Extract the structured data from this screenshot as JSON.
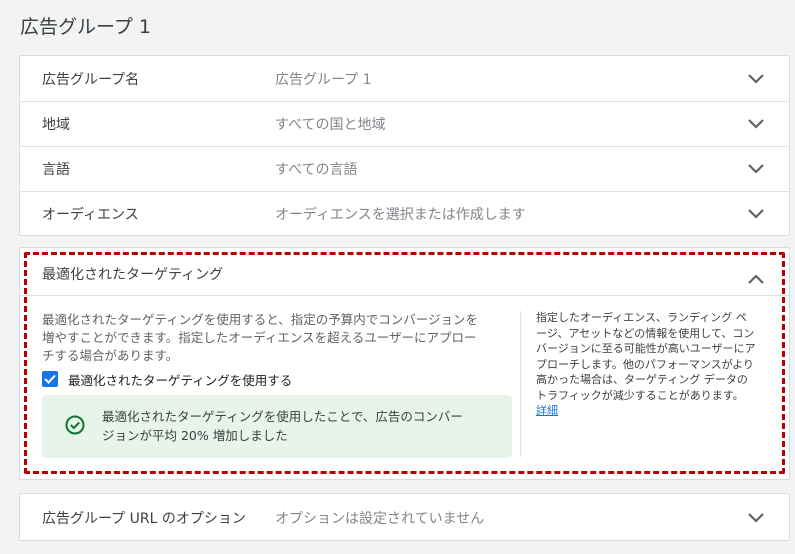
{
  "page_title": "広告グループ 1",
  "settings": [
    {
      "label": "広告グループ名",
      "value": "広告グループ 1"
    },
    {
      "label": "地域",
      "value": "すべての国と地域"
    },
    {
      "label": "言語",
      "value": "すべての言語"
    },
    {
      "label": "オーディエンス",
      "value": "オーディエンスを選択または作成します"
    }
  ],
  "optimized_targeting": {
    "title": "最適化されたターゲティング",
    "description_lines": [
      "最適化されたターゲティングを使用すると、指定の予算内でコンバージョンを",
      "増やすことができます。指定したオーディエンスを超えるユーザーにアプロー",
      "チする場合があります。"
    ],
    "checkbox_label": "最適化されたターゲティングを使用する",
    "checkbox_checked": true,
    "success_lines": [
      "最適化されたターゲティングを使用したことで、広告のコンバー",
      "ジョンが平均 20% 増加しました"
    ],
    "help_lines": [
      "指定したオーディエンス、ランディング ペ",
      "ージ、アセットなどの情報を使用して、コン",
      "バージョンに至る可能性が高いユーザーにア",
      "プローチします。他のパフォーマンスがより",
      "高かった場合は、ターゲティング データの",
      "トラフィックが減少することがあります。"
    ],
    "help_link": "詳細"
  },
  "url_options": {
    "label": "広告グループ URL のオプション",
    "value": "オプションは設定されていません"
  },
  "colors": {
    "accent": "#1a73e8",
    "success_bg": "#e6f4ea",
    "success_icon": "#137333",
    "highlight_border": "#b80000"
  }
}
